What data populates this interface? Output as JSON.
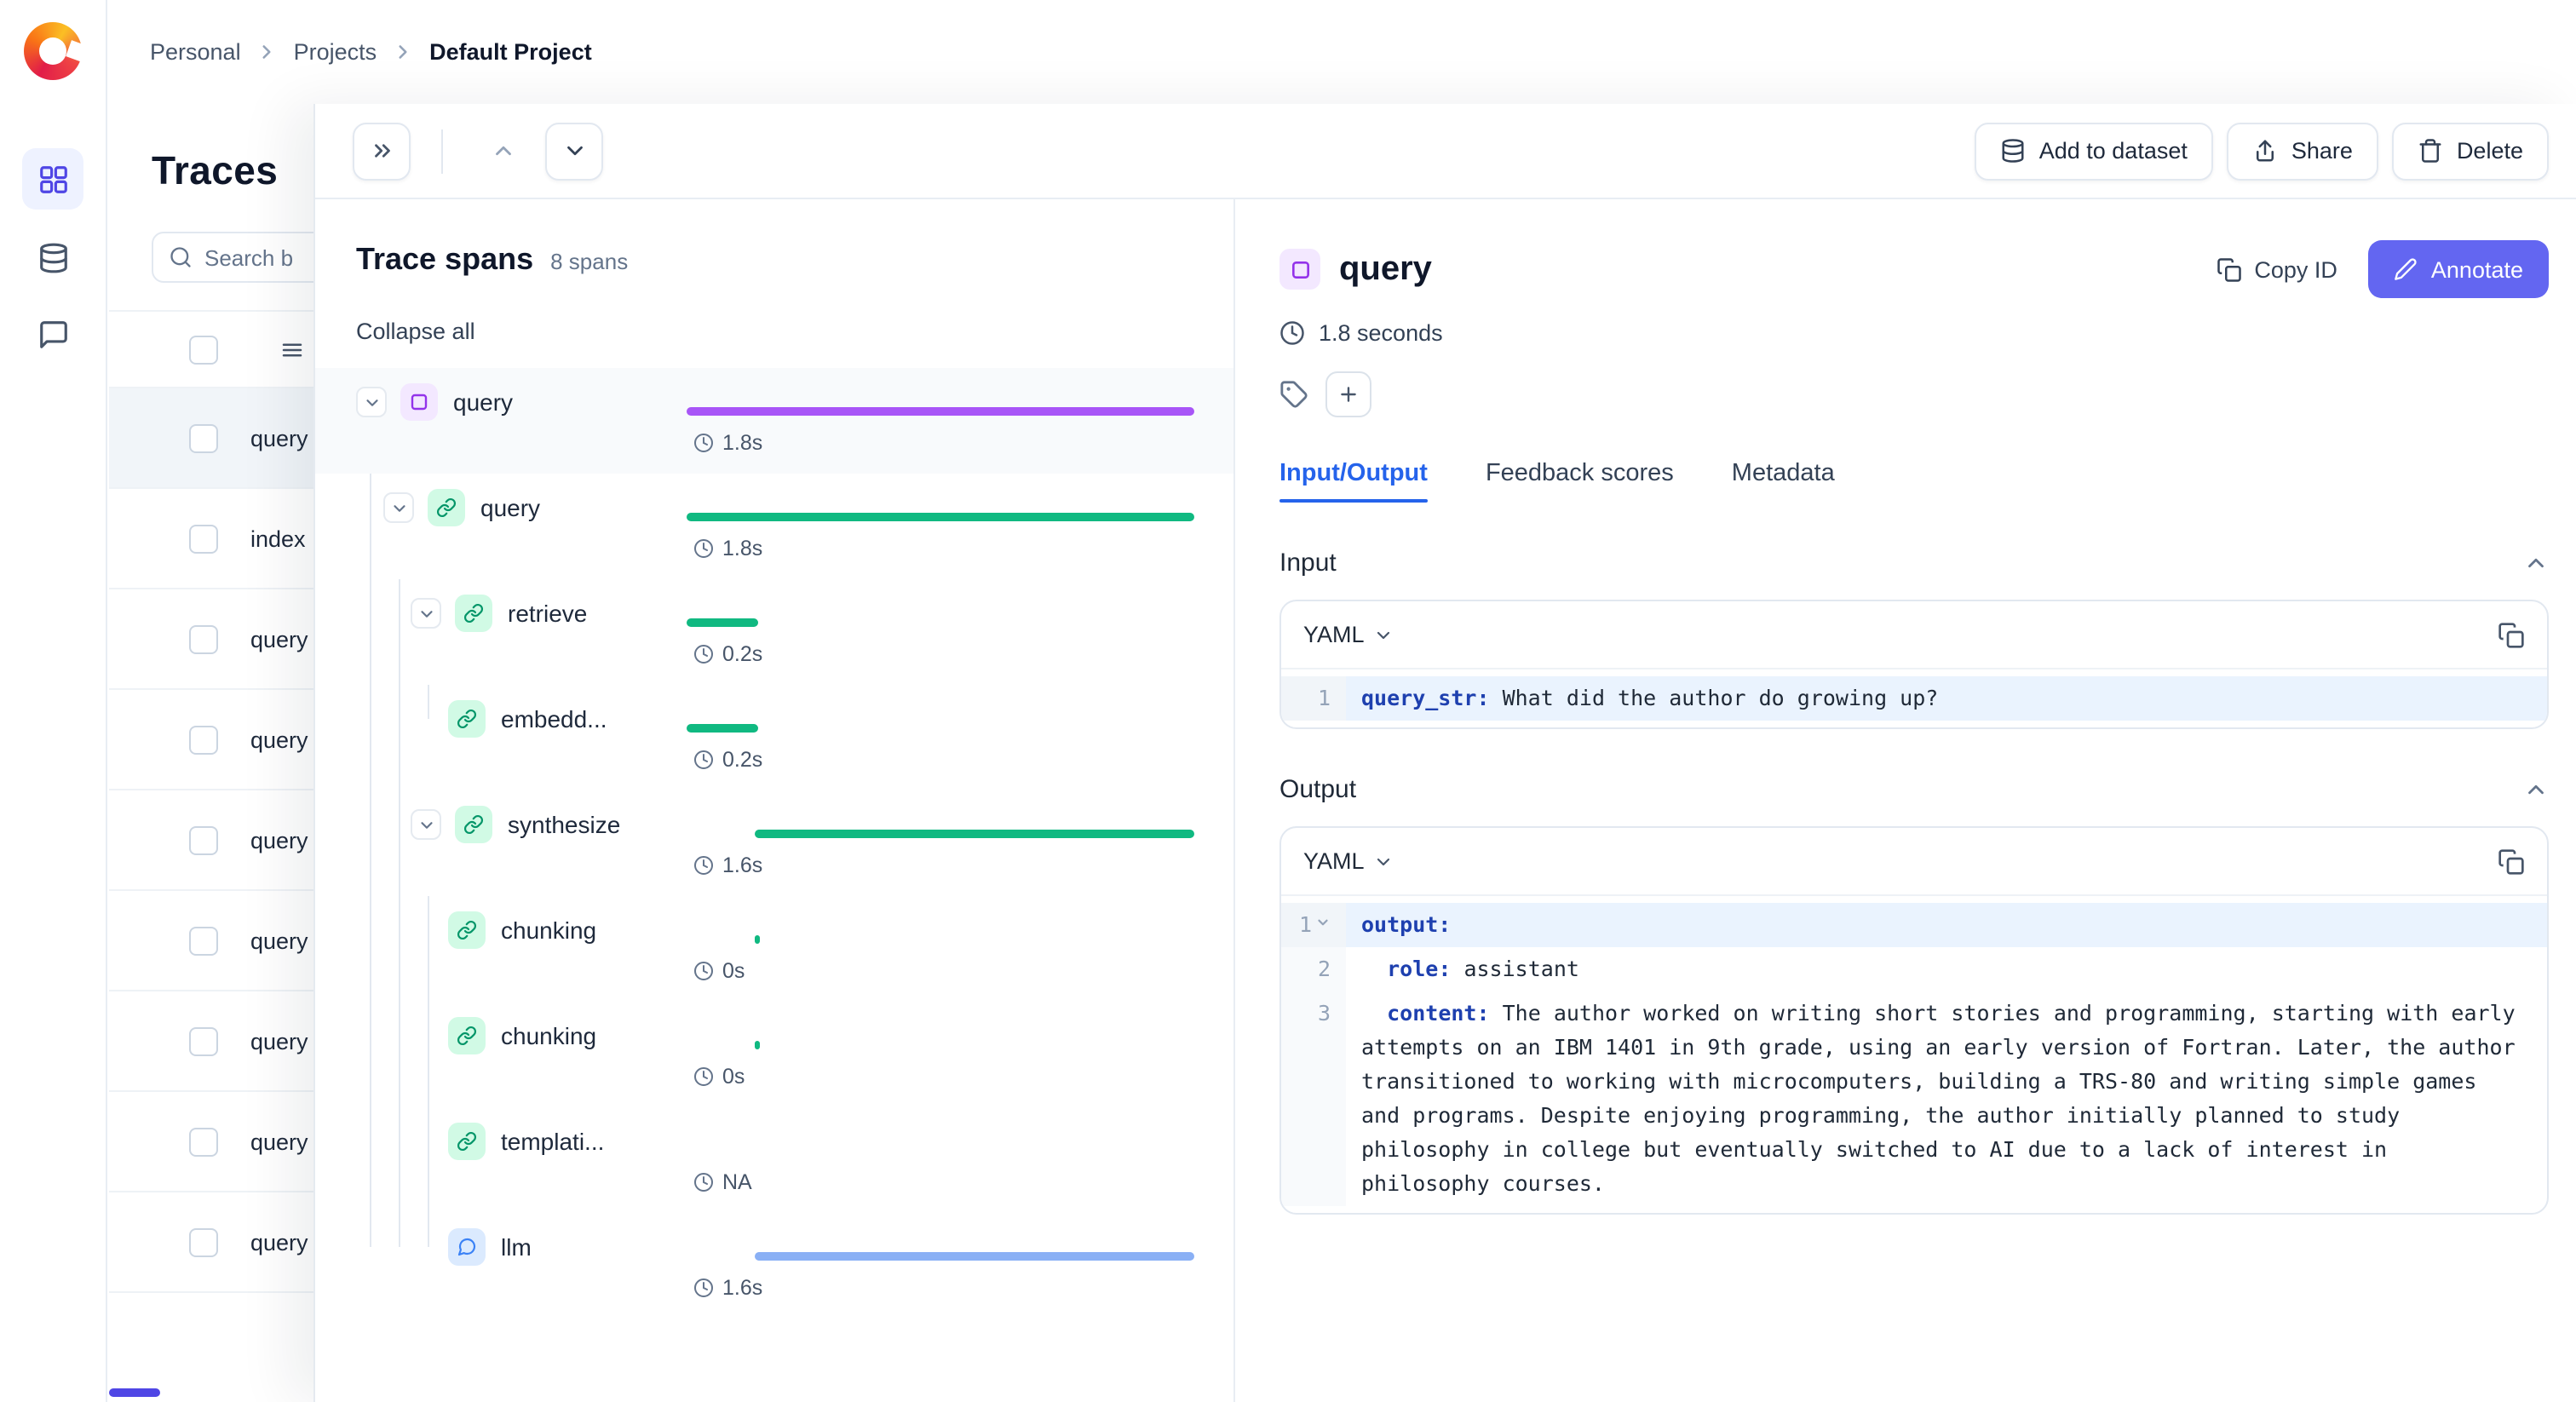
{
  "breadcrumb": {
    "items": [
      "Personal",
      "Projects",
      "Default Project"
    ]
  },
  "sidebar": {
    "icons": [
      "dashboard-icon",
      "database-icon",
      "comments-icon"
    ]
  },
  "traces": {
    "title": "Traces",
    "search_placeholder": "Search b",
    "rows": [
      "query",
      "index",
      "query",
      "query",
      "query",
      "query",
      "query",
      "query",
      "query"
    ]
  },
  "toolbar": {
    "add_to_dataset": "Add to dataset",
    "share": "Share",
    "delete": "Delete"
  },
  "spans": {
    "title": "Trace spans",
    "count": "8 spans",
    "collapse_all": "Collapse all",
    "rows": [
      {
        "name": "query",
        "duration": "1.8s",
        "kind": "trace"
      },
      {
        "name": "query",
        "duration": "1.8s",
        "kind": "span"
      },
      {
        "name": "retrieve",
        "duration": "0.2s",
        "kind": "span"
      },
      {
        "name": "embedd...",
        "duration": "0.2s",
        "kind": "span"
      },
      {
        "name": "synthesize",
        "duration": "1.6s",
        "kind": "span"
      },
      {
        "name": "chunking",
        "duration": "0s",
        "kind": "span"
      },
      {
        "name": "chunking",
        "duration": "0s",
        "kind": "span"
      },
      {
        "name": "templati...",
        "duration": "NA",
        "kind": "span"
      },
      {
        "name": "llm",
        "duration": "1.6s",
        "kind": "llm"
      }
    ]
  },
  "detail": {
    "title": "query",
    "duration": "1.8 seconds",
    "copy_id": "Copy ID",
    "annotate": "Annotate",
    "tabs": [
      "Input/Output",
      "Feedback scores",
      "Metadata"
    ],
    "active_tab": "Input/Output",
    "input": {
      "label": "Input",
      "format": "YAML",
      "lines": [
        {
          "num": "1",
          "key": "query_str:",
          "value": " What did the author do growing up?"
        }
      ]
    },
    "output": {
      "label": "Output",
      "format": "YAML",
      "lines": [
        {
          "num": "1",
          "key": "output:",
          "value": ""
        },
        {
          "num": "2",
          "key": "  role:",
          "value": " assistant"
        },
        {
          "num": "3",
          "key": "  content:",
          "value": " The author worked on writing short stories and programming, starting with early attempts on an IBM 1401 in 9th grade, using an early version of Fortran. Later, the author transitioned to working with microcomputers, building a TRS-80 and writing simple games and programs. Despite enjoying programming, the author initially planned to study philosophy in college but eventually switched to AI due to a lack of interest in philosophy courses."
        }
      ]
    }
  },
  "colors": {
    "trace_purple": "#a855f7",
    "span_green": "#10b981",
    "llm_blue": "#8ab0f5",
    "tab_active": "#2563eb",
    "annotate_bg": "#6366f1",
    "sidebar_active": "#4f46e5"
  }
}
